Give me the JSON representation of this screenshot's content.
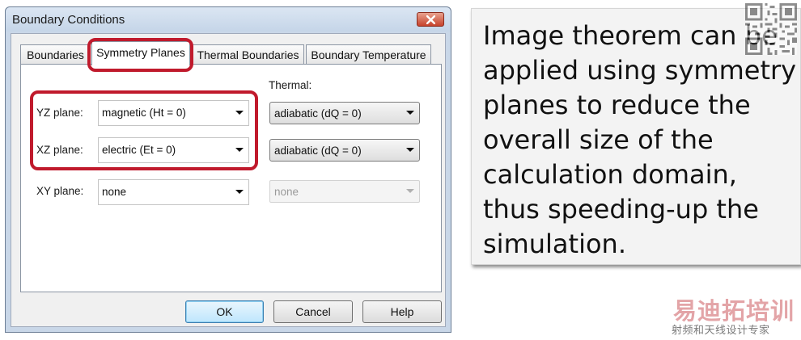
{
  "dialog": {
    "title": "Boundary Conditions",
    "tabs": [
      {
        "label": "Boundaries",
        "active": false
      },
      {
        "label": "Symmetry Planes",
        "active": true
      },
      {
        "label": "Thermal Boundaries",
        "active": false
      },
      {
        "label": "Boundary Temperature",
        "active": false
      }
    ],
    "thermal_header": "Thermal:",
    "planes": [
      {
        "label": "YZ plane:",
        "value": "magnetic (Ht = 0)",
        "thermal": "adiabatic (dQ = 0)",
        "thermal_enabled": true
      },
      {
        "label": "XZ plane:",
        "value": "electric (Et = 0)",
        "thermal": "adiabatic (dQ = 0)",
        "thermal_enabled": true
      },
      {
        "label": "XY plane:",
        "value": "none",
        "thermal": "none",
        "thermal_enabled": false
      }
    ],
    "buttons": {
      "ok": "OK",
      "cancel": "Cancel",
      "help": "Help"
    },
    "highlight_color": "#c01a2c"
  },
  "note": {
    "text": "Image theorem can be applied using symmetry planes to reduce the overall size of the calculation domain, thus speeding-up the simulation."
  },
  "watermark": {
    "brand": "易迪拓培训",
    "tagline": "射频和天线设计专家"
  },
  "icons": [
    "close-icon",
    "qr-code-icon",
    "dropdown-arrow-icon"
  ]
}
